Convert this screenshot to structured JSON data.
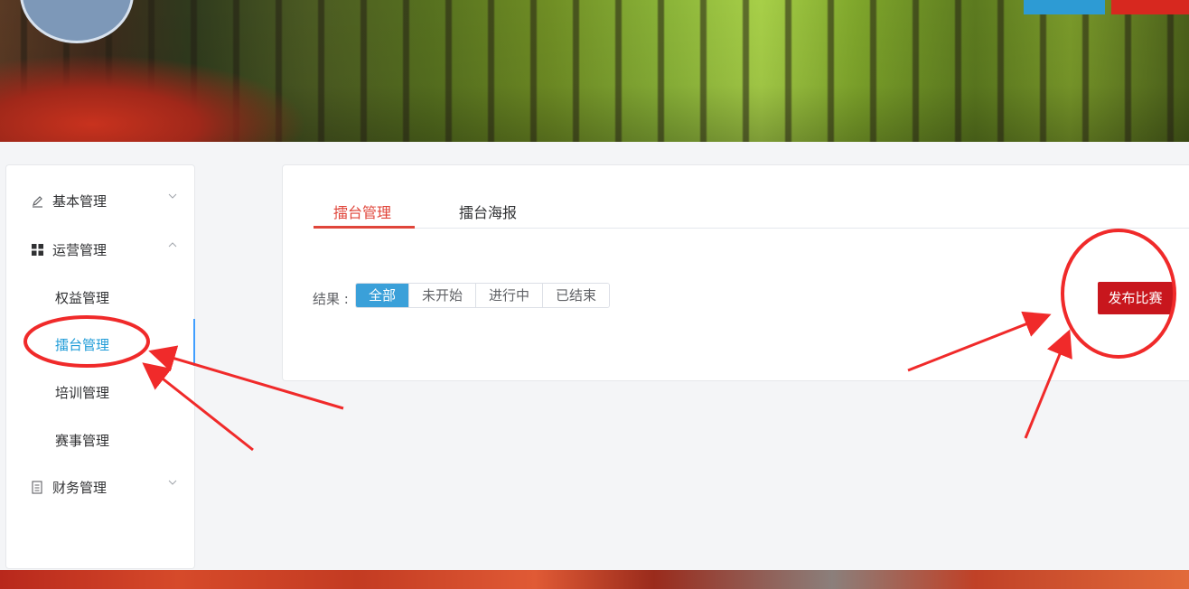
{
  "sidebar": {
    "items": [
      {
        "label": "基本管理",
        "icon": "pencil-icon",
        "expanded": false
      },
      {
        "label": "运营管理",
        "icon": "grid-icon",
        "expanded": true
      },
      {
        "label": "权益管理"
      },
      {
        "label": "擂台管理",
        "active": true
      },
      {
        "label": "培训管理"
      },
      {
        "label": "赛事管理"
      },
      {
        "label": "财务管理",
        "icon": "document-icon",
        "expanded": false
      }
    ]
  },
  "main": {
    "tabs": [
      {
        "label": "擂台管理",
        "active": true
      },
      {
        "label": "擂台海报",
        "active": false
      }
    ],
    "filter": {
      "label": "结果 :",
      "options": [
        "全部",
        "未开始",
        "进行中",
        "已结束"
      ],
      "selected": "全部"
    },
    "publish_button": "发布比赛"
  },
  "colors": {
    "accent_red": "#c8161d",
    "tab_red": "#e0453a",
    "active_blue": "#1e9bd7",
    "segment_blue": "#3aa0d9",
    "annotation_red": "#f02a2a"
  }
}
